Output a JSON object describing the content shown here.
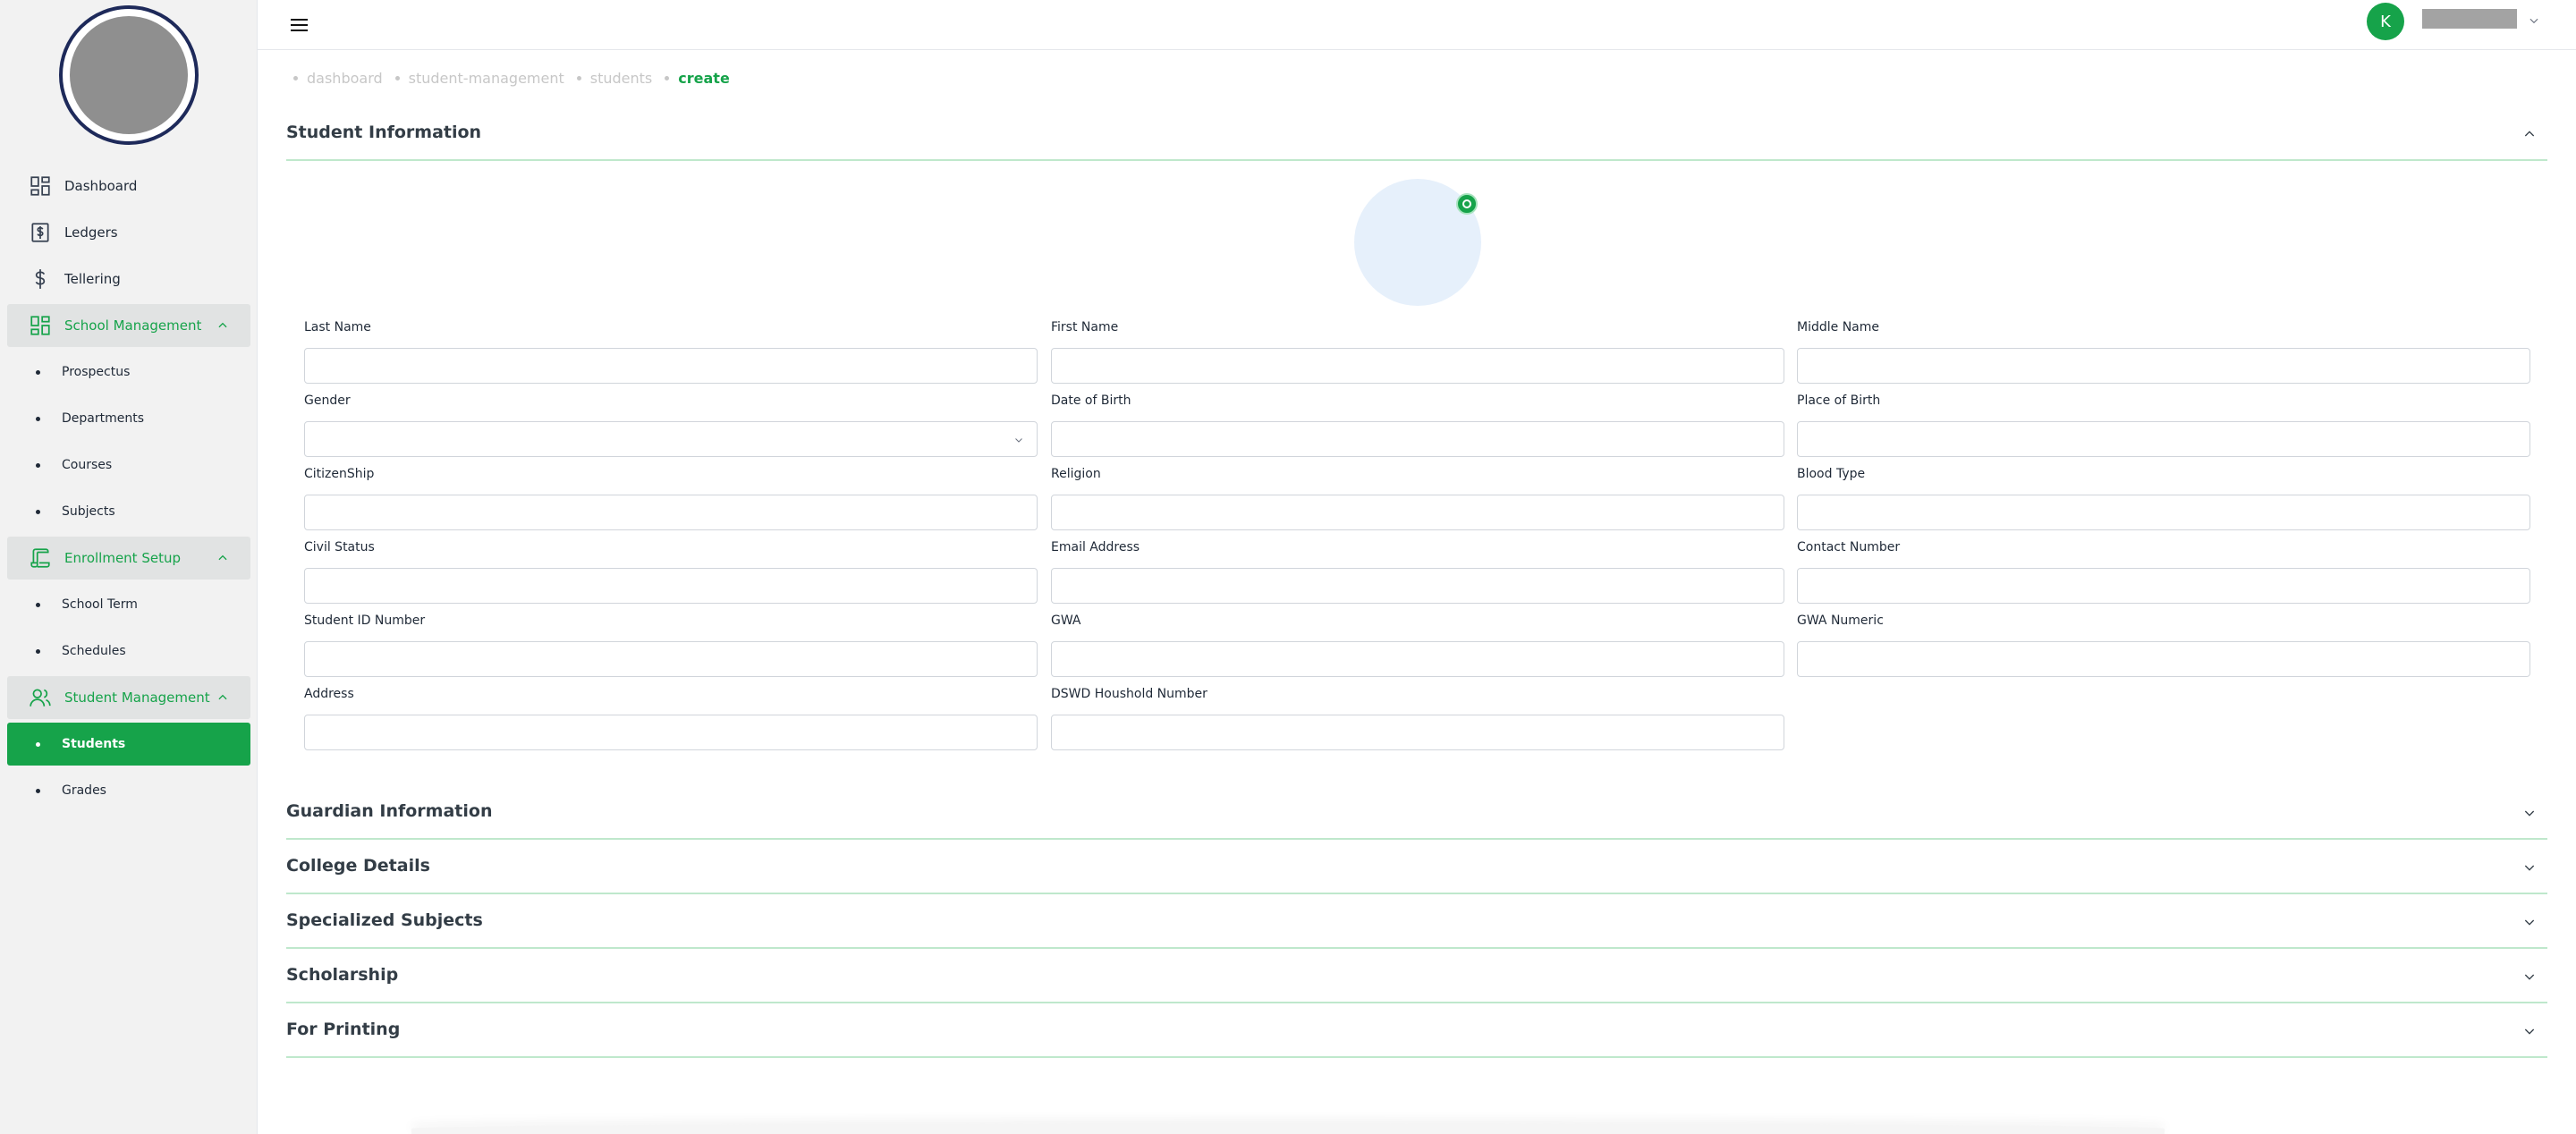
{
  "sidebar": {
    "items": [
      {
        "label": "Dashboard",
        "icon": "dashboard-grid-icon"
      },
      {
        "label": "Ledgers",
        "icon": "ledger-dollar-icon"
      },
      {
        "label": "Tellering",
        "icon": "dollar-icon"
      }
    ],
    "groups": [
      {
        "label": "School Management",
        "icon": "dashboard-grid-icon",
        "subs": [
          "Prospectus",
          "Departments",
          "Courses",
          "Subjects"
        ]
      },
      {
        "label": "Enrollment Setup",
        "icon": "scroll-icon",
        "subs": [
          "School Term",
          "Schedules"
        ]
      },
      {
        "label": "Student Management",
        "icon": "users-icon",
        "subs": [
          "Students",
          "Grades"
        ]
      }
    ],
    "active": "Students"
  },
  "header": {
    "avatar_initial": "K",
    "accent": "#16a34a"
  },
  "breadcrumb": [
    "dashboard",
    "student-management",
    "students",
    "create"
  ],
  "sections": {
    "student_information": "Student Information",
    "guardian_information": "Guardian Information",
    "college_details": "College Details",
    "specialized_subjects": "Specialized Subjects",
    "scholarship": "Scholarship",
    "for_printing": "For Printing"
  },
  "form": {
    "last_name": {
      "label": "Last Name",
      "value": ""
    },
    "first_name": {
      "label": "First Name",
      "value": ""
    },
    "middle_name": {
      "label": "Middle Name",
      "value": ""
    },
    "gender": {
      "label": "Gender",
      "value": ""
    },
    "date_of_birth": {
      "label": "Date of Birth",
      "value": ""
    },
    "place_of_birth": {
      "label": "Place of Birth",
      "value": ""
    },
    "citizenship": {
      "label": "CitizenShip",
      "value": ""
    },
    "religion": {
      "label": "Religion",
      "value": ""
    },
    "blood_type": {
      "label": "Blood Type",
      "value": ""
    },
    "civil_status": {
      "label": "Civil Status",
      "value": ""
    },
    "email_address": {
      "label": "Email Address",
      "value": ""
    },
    "contact_number": {
      "label": "Contact Number",
      "value": ""
    },
    "student_id_number": {
      "label": "Student ID Number",
      "value": ""
    },
    "gwa": {
      "label": "GWA",
      "value": ""
    },
    "gwa_numeric": {
      "label": "GWA Numeric",
      "value": ""
    },
    "address": {
      "label": "Address",
      "value": ""
    },
    "dswd_household_number": {
      "label": "DSWD Houshold Number",
      "value": ""
    }
  }
}
